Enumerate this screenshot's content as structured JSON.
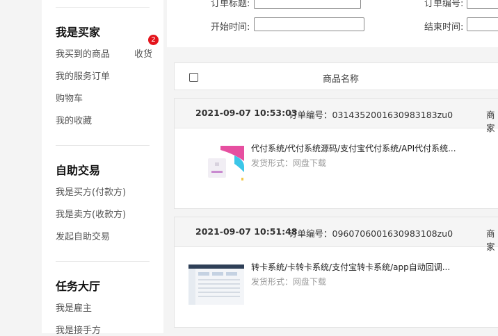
{
  "sidebar": {
    "sections": [
      {
        "title": "我是买家",
        "items": [
          "我买到的商品",
          "我的服务订单",
          "购物车",
          "我的收藏"
        ]
      },
      {
        "title": "自助交易",
        "items": [
          "我是买方(付款方)",
          "我是卖方(收款方)",
          "发起自助交易"
        ]
      },
      {
        "title": "任务大厅",
        "items": [
          "我是雇主",
          "我是接手方"
        ]
      }
    ],
    "receive_label": "收货",
    "receive_badge": "2"
  },
  "filter": {
    "order_title_label": "订单标题:",
    "order_no_label": "订单编号:",
    "start_time_label": "开始时间:",
    "end_time_label": "结束时间:"
  },
  "table": {
    "column_product": "商品名称"
  },
  "orders": [
    {
      "date": "2021-09-07 10:53:03",
      "order_no": "订单编号：0314352001630983183zu0",
      "merchant": "商家",
      "title": "代付系统/代付系统源码/支付宝代付系统/API代付系统...",
      "ship": "发货形式：网盘下载"
    },
    {
      "date": "2021-09-07 10:51:48",
      "order_no": "订单编号：0960706001630983108zu0",
      "merchant": "商家",
      "title": "转卡系统/卡转卡系统/支付宝转卡系统/app自动回调...",
      "ship": "发货形式：网盘下载"
    }
  ],
  "colors": {
    "badge": "#e4141c",
    "accent_thumb1": "#e64fa0",
    "accent_thumb1b": "#3cc6e8"
  }
}
